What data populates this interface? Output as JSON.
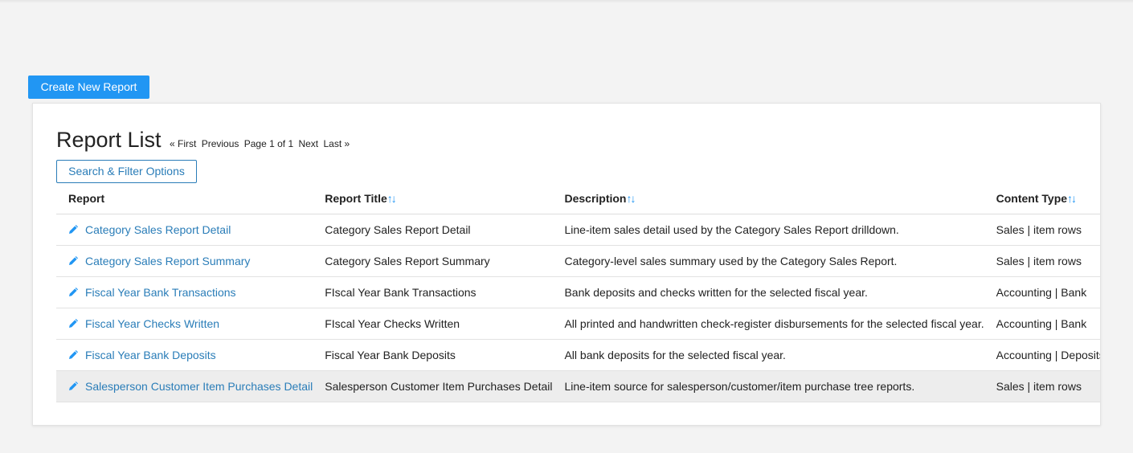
{
  "toolbar": {
    "create_label": "Create New Report"
  },
  "card": {
    "title": "Report List",
    "pager": {
      "first": "« First",
      "previous": "Previous",
      "page_info": "Page 1 of 1",
      "next": "Next",
      "last": "Last »"
    },
    "filter_label": "Search & Filter Options"
  },
  "table": {
    "headers": {
      "report": "Report",
      "title": "Report Title",
      "description": "Description",
      "content_type": "Content Type",
      "sort_glyph": "↑↓"
    },
    "rows": [
      {
        "report": "Category Sales Report Detail",
        "title": "Category Sales Report Detail",
        "description": "Line-item sales detail used by the Category Sales Report drilldown.",
        "content_type": "Sales | item rows"
      },
      {
        "report": "Category Sales Report Summary",
        "title": "Category Sales Report Summary",
        "description": "Category-level sales summary used by the Category Sales Report.",
        "content_type": "Sales | item rows"
      },
      {
        "report": "Fiscal Year Bank Transactions",
        "title": "FIscal Year Bank Transactions",
        "description": "Bank deposits and checks written for the selected fiscal year.",
        "content_type": "Accounting | Bank"
      },
      {
        "report": "Fiscal Year Checks Written",
        "title": "FIscal Year Checks Written",
        "description": "All printed and handwritten check-register disbursements for the selected fiscal year.",
        "content_type": "Accounting | Bank"
      },
      {
        "report": "Fiscal Year Bank Deposits",
        "title": "Fiscal Year Bank Deposits",
        "description": "All bank deposits for the selected fiscal year.",
        "content_type": "Accounting | Deposits"
      },
      {
        "report": "Salesperson Customer Item Purchases Detail",
        "title": "Salesperson Customer Item Purchases Detail",
        "description": "Line-item source for salesperson/customer/item purchase tree reports.",
        "content_type": "Sales | item rows"
      }
    ]
  },
  "colors": {
    "accent": "#2196f3",
    "link": "#2a7db8",
    "highlight_row": "#ededed"
  },
  "icons": {
    "edit": "pencil-icon"
  }
}
